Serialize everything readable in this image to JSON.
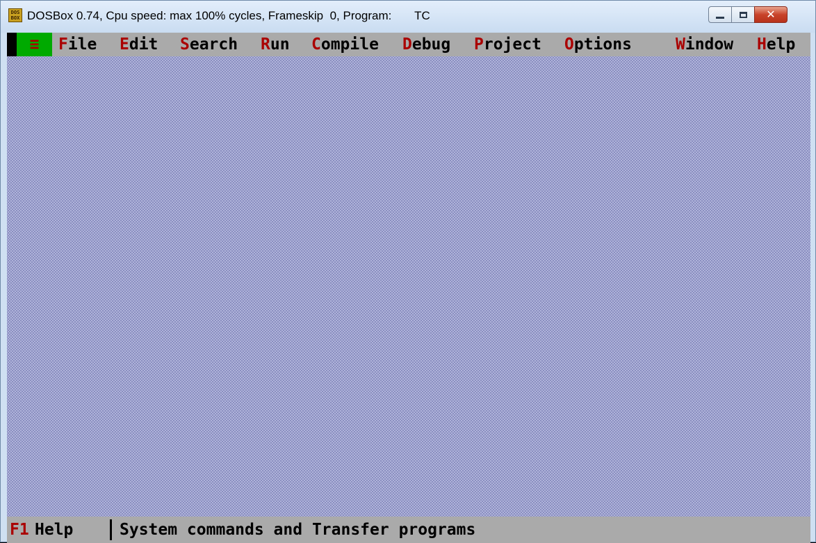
{
  "window": {
    "title": "DOSBox 0.74, Cpu speed: max 100% cycles, Frameskip  0, Program:       TC",
    "icon": "dosbox-icon",
    "icon_text": "DOS BOX",
    "close_glyph": "✕"
  },
  "menubar": {
    "system_label": "≡",
    "items": [
      {
        "hot": "F",
        "rest": "ile"
      },
      {
        "hot": "E",
        "rest": "dit"
      },
      {
        "hot": "S",
        "rest": "earch"
      },
      {
        "hot": "R",
        "rest": "un"
      },
      {
        "hot": "C",
        "rest": "ompile"
      },
      {
        "hot": "D",
        "rest": "ebug"
      },
      {
        "hot": "P",
        "rest": "roject"
      },
      {
        "hot": "O",
        "rest": "ptions"
      },
      {
        "hot": "W",
        "rest": "indow"
      },
      {
        "hot": "H",
        "rest": "elp"
      }
    ]
  },
  "statusbar": {
    "key": "F1",
    "key_label": "Help",
    "message": "System commands and Transfer programs"
  },
  "colors": {
    "desktop": "#8a8ec0",
    "menu_bg": "#aaaaaa",
    "hotkey": "#aa0000",
    "system_menu_bg": "#00aa00"
  }
}
